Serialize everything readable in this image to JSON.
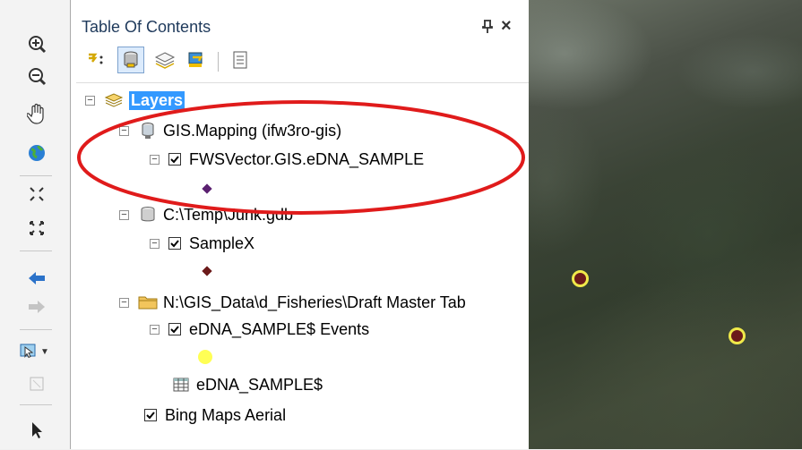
{
  "toc": {
    "title": "Table Of Contents",
    "pin_glyph": "⊥",
    "close_glyph": "×"
  },
  "tree": {
    "root": "Layers",
    "group1": "GIS.Mapping (ifw3ro-gis)",
    "layer1": "FWSVector.GIS.eDNA_SAMPLE",
    "group2": "C:\\Temp\\Junk.gdb",
    "layer2": "SampleX",
    "group3": "N:\\GIS_Data\\d_Fisheries\\Draft Master Tab",
    "layer3": "eDNA_SAMPLE$ Events",
    "table1": "eDNA_SAMPLE$",
    "basemap": "Bing Maps Aerial"
  },
  "colors": {
    "annotation": "#e01b1b",
    "symbol_purple": "#5b2070",
    "symbol_darkred": "#6b1a1a",
    "symbol_yellow": "#ffff55",
    "point_outline": "#f0e94a"
  }
}
